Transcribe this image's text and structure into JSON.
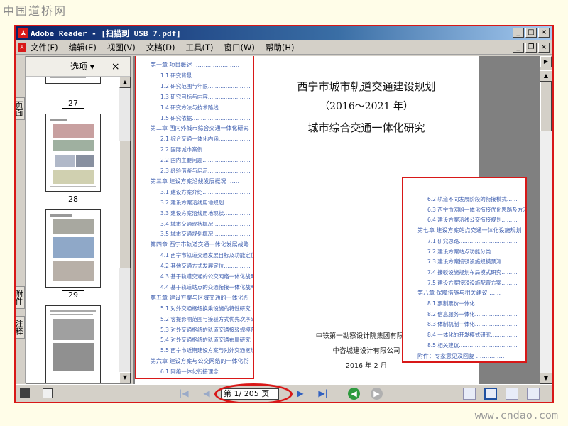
{
  "watermark": {
    "top": "中国道桥网",
    "bottom": "www.cndao.com"
  },
  "window": {
    "title": "Adobe Reader - [扫描到 USB 7.pdf]",
    "app_icon": "adobe-reader-icon"
  },
  "menu": {
    "items": [
      "文件(F)",
      "编辑(E)",
      "视图(V)",
      "文档(D)",
      "工具(T)",
      "窗口(W)",
      "帮助(H)"
    ]
  },
  "side_tabs": [
    "页面",
    "附件",
    "注释"
  ],
  "thumbnail_panel": {
    "options_label": "选项 ▾",
    "close_label": "×",
    "pages": [
      "27",
      "28",
      "29"
    ]
  },
  "document": {
    "title_line1": "西宁市城市轨道交通建设规划",
    "title_line2": "（2016～2021 年）",
    "title_line3": "城市综合交通一体化研究",
    "org_line1": "中铁第一勘察设计院集团有限公司",
    "org_line2": "中咨城建设计有限公司",
    "date": "2016 年 2 月",
    "toc_left": [
      {
        "text": "第一章   项目概述 ……………………",
        "level": 1
      },
      {
        "text": "1.1  研究背景……………………………",
        "level": 2
      },
      {
        "text": "1.2  研究范围与年限……………………",
        "level": 2
      },
      {
        "text": "1.3  研究目标与内容……………………",
        "level": 2
      },
      {
        "text": "1.4  研究方法与技术路线………………",
        "level": 2
      },
      {
        "text": "1.5  研究依据……………………………",
        "level": 2
      },
      {
        "text": "第二章   国内外城市综合交通一体化研究",
        "level": 1
      },
      {
        "text": "2.1  综合交通一体化内涵………………",
        "level": 2
      },
      {
        "text": "2.2  国际城市案例………………………",
        "level": 2
      },
      {
        "text": "2.2  国内主要问题………………………",
        "level": 2
      },
      {
        "text": "2.3  经验借鉴与启示……………………",
        "level": 2
      },
      {
        "text": "第三章   建设方案沿线发展概况 ……",
        "level": 1
      },
      {
        "text": "3.1  建设方案介绍………………………",
        "level": 2
      },
      {
        "text": "3.2  建设方案沿线用地规划……………",
        "level": 2
      },
      {
        "text": "3.3  建设方案沿线用地现状……………",
        "level": 2
      },
      {
        "text": "3.4  城市交通现状概况…………………",
        "level": 2
      },
      {
        "text": "3.5  城市交通规划概况…………………",
        "level": 2
      },
      {
        "text": "第四章   西宁市轨道交通一体化发展战略",
        "level": 1
      },
      {
        "text": "4.1  西宁市轨道交通发展目标及功能定位",
        "level": 2
      },
      {
        "text": "4.2  其他交通方式发展定位……………",
        "level": 2
      },
      {
        "text": "4.3  基于轨道交通的公交网络一体化战略",
        "level": 2
      },
      {
        "text": "4.4  基于轨道站点的交通衔接一体化战略",
        "level": 2
      },
      {
        "text": "第五章   建设方案与区域交通的一体化衔",
        "level": 1
      },
      {
        "text": "5.1  对外交通枢纽换乘设施的特性研究",
        "level": 2
      },
      {
        "text": "5.2  客提影响范围与接驳方式优先次序研究",
        "level": 2
      },
      {
        "text": "5.3  对外交通枢纽的轨道交通接驳规模预测",
        "level": 2
      },
      {
        "text": "5.4  对外交通枢纽的轨道交通布局研究",
        "level": 2
      },
      {
        "text": "5.5  西宁市近期建设方案与对外交通枢纽一",
        "level": 2
      },
      {
        "text": "第六章   建设方案与公交网络的一体化衔",
        "level": 1
      },
      {
        "text": "6.1  网络一体化衔接理念………………",
        "level": 2
      }
    ],
    "toc_right": [
      {
        "text": "6.2  轨道不同发展阶段的衔接模式……",
        "level": 2
      },
      {
        "text": "6.3  西宁市网络一体化衔接优化思路及方法",
        "level": 2
      },
      {
        "text": "6.4  建设方案沿线公交衔接规划………",
        "level": 2
      },
      {
        "text": "第七章   建设方案站点交通一体化设施规划",
        "level": 1
      },
      {
        "text": "7.1  研究思路……………………………",
        "level": 2
      },
      {
        "text": "7.2  建设方案站点功能分类……………",
        "level": 2
      },
      {
        "text": "7.3  建设方案接驳设施规模预测………",
        "level": 2
      },
      {
        "text": "7.4  接驳设施规划布局模式研究………",
        "level": 2
      },
      {
        "text": "7.5  建设方案接驳设施配置方案………",
        "level": 2
      },
      {
        "text": "第八章   保障措施与相关建议 ……",
        "level": 1
      },
      {
        "text": "8.1  票制票价一体化……………………",
        "level": 2
      },
      {
        "text": "8.2  信息服务一体化……………………",
        "level": 2
      },
      {
        "text": "8.3  体制机制一体化……………………",
        "level": 2
      },
      {
        "text": "8.4  一体化的开发模式研究……………",
        "level": 2
      },
      {
        "text": "8.5  相关建议……………………………",
        "level": 2
      },
      {
        "text": "附件：专家意见及回复 ……………",
        "level": 1
      }
    ]
  },
  "statusbar": {
    "page_indicator": "第 1/ 205 页"
  },
  "colors": {
    "highlight": "#d81818",
    "titlebar": "#0a246a",
    "toc_text": "#4060b0"
  }
}
